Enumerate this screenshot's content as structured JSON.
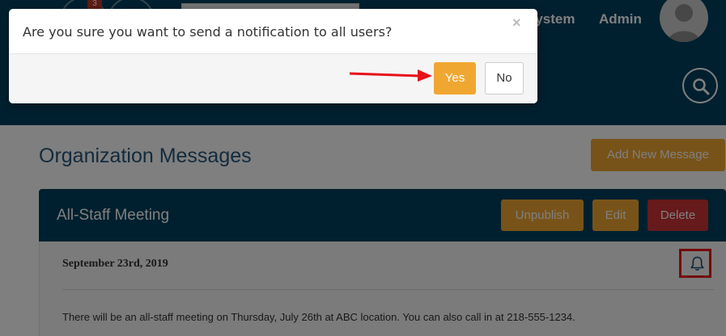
{
  "header": {
    "notification_count": "3",
    "nav": [
      "System",
      "Admin"
    ]
  },
  "page": {
    "title": "Organization Messages",
    "add_button": "Add New Message"
  },
  "message": {
    "title": "All-Staff Meeting",
    "unpublish_label": "Unpublish",
    "edit_label": "Edit",
    "delete_label": "Delete",
    "date": "September 23rd, 2019",
    "body": "There will be an all-staff meeting on Thursday, July 26th at ABC location. You can also call in at 218-555-1234."
  },
  "modal": {
    "question": "Are you sure you want to send a notification to all users?",
    "close_symbol": "×",
    "yes_label": "Yes",
    "no_label": "No"
  },
  "colors": {
    "header_bg": "#00405f",
    "accent_orange": "#f0a732",
    "danger_red": "#cc3437",
    "highlight_red": "#e8101a"
  },
  "icons": [
    "search-icon",
    "user-avatar-icon",
    "bell-icon",
    "close-icon",
    "annotation-arrow"
  ]
}
